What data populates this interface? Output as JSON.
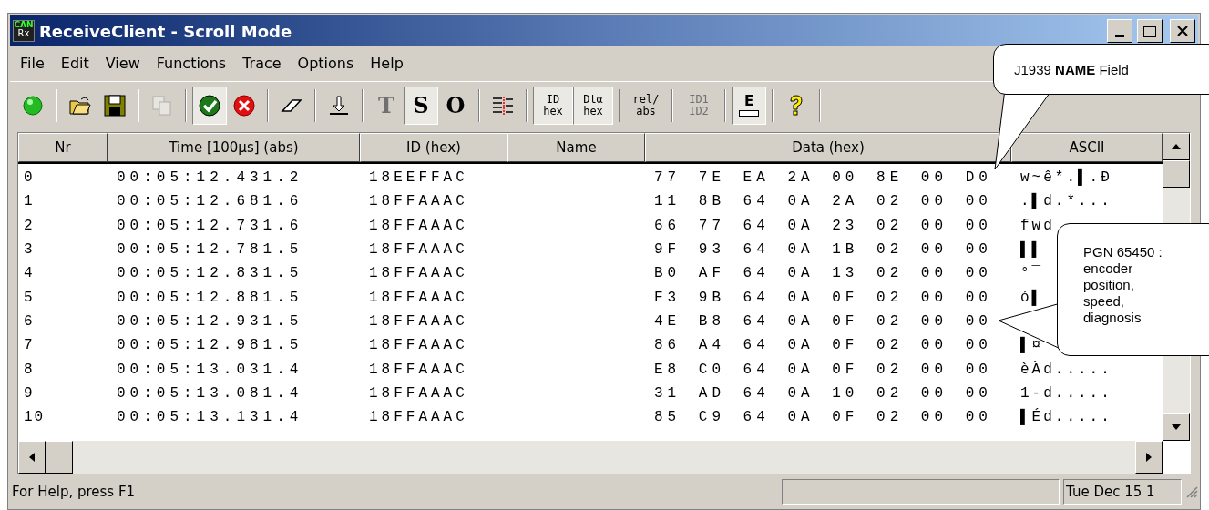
{
  "window": {
    "app_icon": {
      "top": "CAN",
      "bottom": "Rx"
    },
    "title": "ReceiveClient - Scroll Mode"
  },
  "menu": [
    "File",
    "Edit",
    "View",
    "Functions",
    "Trace",
    "Options",
    "Help"
  ],
  "toolbar": [
    [
      {
        "kind": "led",
        "pressed": false,
        "disabled": false
      }
    ],
    [
      {
        "kind": "open",
        "pressed": false,
        "disabled": false
      },
      {
        "kind": "save",
        "pressed": false,
        "disabled": false
      }
    ],
    [
      {
        "kind": "copy",
        "pressed": false,
        "disabled": true
      }
    ],
    [
      {
        "kind": "check",
        "pressed": true,
        "disabled": false
      },
      {
        "kind": "cancel",
        "pressed": false,
        "disabled": false
      }
    ],
    [
      {
        "kind": "eraser",
        "pressed": false,
        "disabled": false
      }
    ],
    [
      {
        "kind": "download",
        "pressed": false,
        "disabled": false
      }
    ],
    [
      {
        "kind": "letter",
        "label": "T",
        "pressed": false,
        "disabled": true
      },
      {
        "kind": "letter",
        "label": "S",
        "pressed": true,
        "disabled": false
      },
      {
        "kind": "letter",
        "label": "O",
        "pressed": false,
        "disabled": false
      }
    ],
    [
      {
        "kind": "columns",
        "pressed": false,
        "disabled": false
      }
    ],
    [
      {
        "kind": "caption",
        "label": "ID hex",
        "pressed": true,
        "disabled": false
      },
      {
        "kind": "caption",
        "label": "Dtα hex",
        "pressed": true,
        "disabled": false
      }
    ],
    [
      {
        "kind": "caption",
        "label": "rel/ abs",
        "pressed": false,
        "disabled": false
      }
    ],
    [
      {
        "kind": "caption",
        "label": "ID1 ID2",
        "pressed": false,
        "disabled": true
      }
    ],
    [
      {
        "kind": "export",
        "label": "E",
        "pressed": true,
        "disabled": false
      }
    ],
    [
      {
        "kind": "help",
        "pressed": false,
        "disabled": false
      }
    ]
  ],
  "table": {
    "columns": [
      "Nr",
      "Time [100µs] (abs)",
      "ID (hex)",
      "Name",
      "Data (hex)",
      "ASCII"
    ],
    "rows": [
      {
        "nr": "0",
        "time": "00:05:12.431.2",
        "id": "18EEFFAC",
        "data": "77 7E EA 2A 00 8E 00 D0",
        "ascii": "w~ê*.▌.Ð"
      },
      {
        "nr": "1",
        "time": "00:05:12.681.6",
        "id": "18FFAAAC",
        "data": "11 8B 64 0A 2A 02 00 00",
        "ascii": ".▌d.*..."
      },
      {
        "nr": "2",
        "time": "00:05:12.731.6",
        "id": "18FFAAAC",
        "data": "66 77 64 0A 23 02 00 00",
        "ascii": "fwd"
      },
      {
        "nr": "3",
        "time": "00:05:12.781.5",
        "id": "18FFAAAC",
        "data": "9F 93 64 0A 1B 02 00 00",
        "ascii": "▌▌"
      },
      {
        "nr": "4",
        "time": "00:05:12.831.5",
        "id": "18FFAAAC",
        "data": "B0 AF 64 0A 13 02 00 00",
        "ascii": "°¯"
      },
      {
        "nr": "5",
        "time": "00:05:12.881.5",
        "id": "18FFAAAC",
        "data": "F3 9B 64 0A 0F 02 00 00",
        "ascii": "ó▌"
      },
      {
        "nr": "6",
        "time": "00:05:12.931.5",
        "id": "18FFAAAC",
        "data": "4E B8 64 0A 0F 02 00 00"
      },
      {
        "nr": "7",
        "time": "00:05:12.981.5",
        "id": "18FFAAAC",
        "data": "86 A4 64 0A 0F 02 00 00",
        "ascii": "▌¤"
      },
      {
        "nr": "8",
        "time": "00:05:13.031.4",
        "id": "18FFAAAC",
        "data": "E8 C0 64 0A 0F 02 00 00",
        "ascii": "èÀd....."
      },
      {
        "nr": "9",
        "time": "00:05:13.081.4",
        "id": "18FFAAAC",
        "data": "31 AD 64 0A 10 02 00 00",
        "ascii": "1-d....."
      },
      {
        "nr": "10",
        "time": "00:05:13.131.4",
        "id": "18FFAAAC",
        "data": "85 C9 64 0A 0F 02 00 00",
        "ascii": "▌Éd....."
      }
    ]
  },
  "status_bar": {
    "help": "For Help, press F1",
    "clock": "Tue Dec 15 1"
  },
  "callouts": [
    {
      "kind": "top",
      "html": "J1939 **NAME** Field"
    },
    {
      "kind": "side",
      "html": "PGN 65450 : encoder position, speed, diagnosis"
    }
  ]
}
